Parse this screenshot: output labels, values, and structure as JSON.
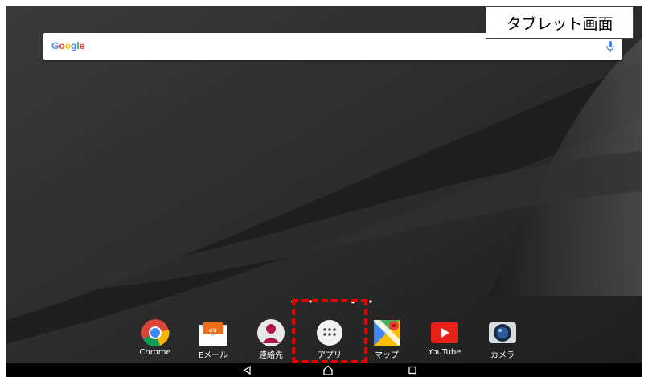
{
  "caption": "タブレット画面",
  "search": {
    "logo_text": "Google",
    "mic_icon": "microphone-icon"
  },
  "dock": {
    "items": [
      {
        "label": "Chrome",
        "icon": "chrome-icon"
      },
      {
        "label": "Eメール",
        "icon": "email-icon"
      },
      {
        "label": "連絡先",
        "icon": "contacts-icon"
      },
      {
        "label": "アプリ",
        "icon": "app-drawer-icon"
      },
      {
        "label": "マップ",
        "icon": "maps-icon"
      },
      {
        "label": "YouTube",
        "icon": "youtube-icon"
      },
      {
        "label": "カメラ",
        "icon": "camera-icon"
      }
    ],
    "email_badge": "au"
  },
  "nav": {
    "back": "back-icon",
    "home": "home-icon",
    "recents": "recents-icon"
  },
  "colors": {
    "highlight": "#e60000",
    "wallpaper": "#2a2a2a"
  }
}
